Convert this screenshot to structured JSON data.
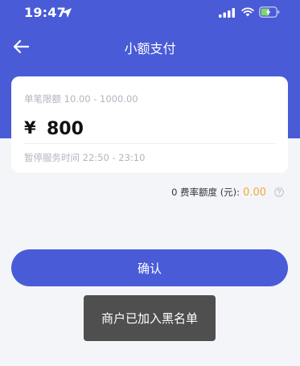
{
  "status_bar": {
    "time": "19:47",
    "icons": [
      "location-arrow-icon",
      "cellular-signal-icon",
      "wifi-icon",
      "battery-charging-icon"
    ]
  },
  "nav": {
    "back_icon": "arrow-left-icon",
    "title": "小额支付"
  },
  "card": {
    "limit_label": "单笔限额 10.00 - 1000.00",
    "currency_symbol": "¥",
    "amount_value": "800",
    "pause_label": "暂停服务时间 22:50 - 23:10"
  },
  "fee": {
    "label": "0 费率额度 (元):",
    "value": "0.00",
    "help_icon": "question-circle-icon"
  },
  "confirm_button": {
    "label": "确认"
  },
  "toast": {
    "message": "商户已加入黑名单"
  },
  "colors": {
    "brand": "#4a5bd8",
    "background": "#f4f5f9",
    "accent_amount": "#f0a93a",
    "toast_bg": "#4f4f4f",
    "muted_text": "#b2b5bd"
  }
}
